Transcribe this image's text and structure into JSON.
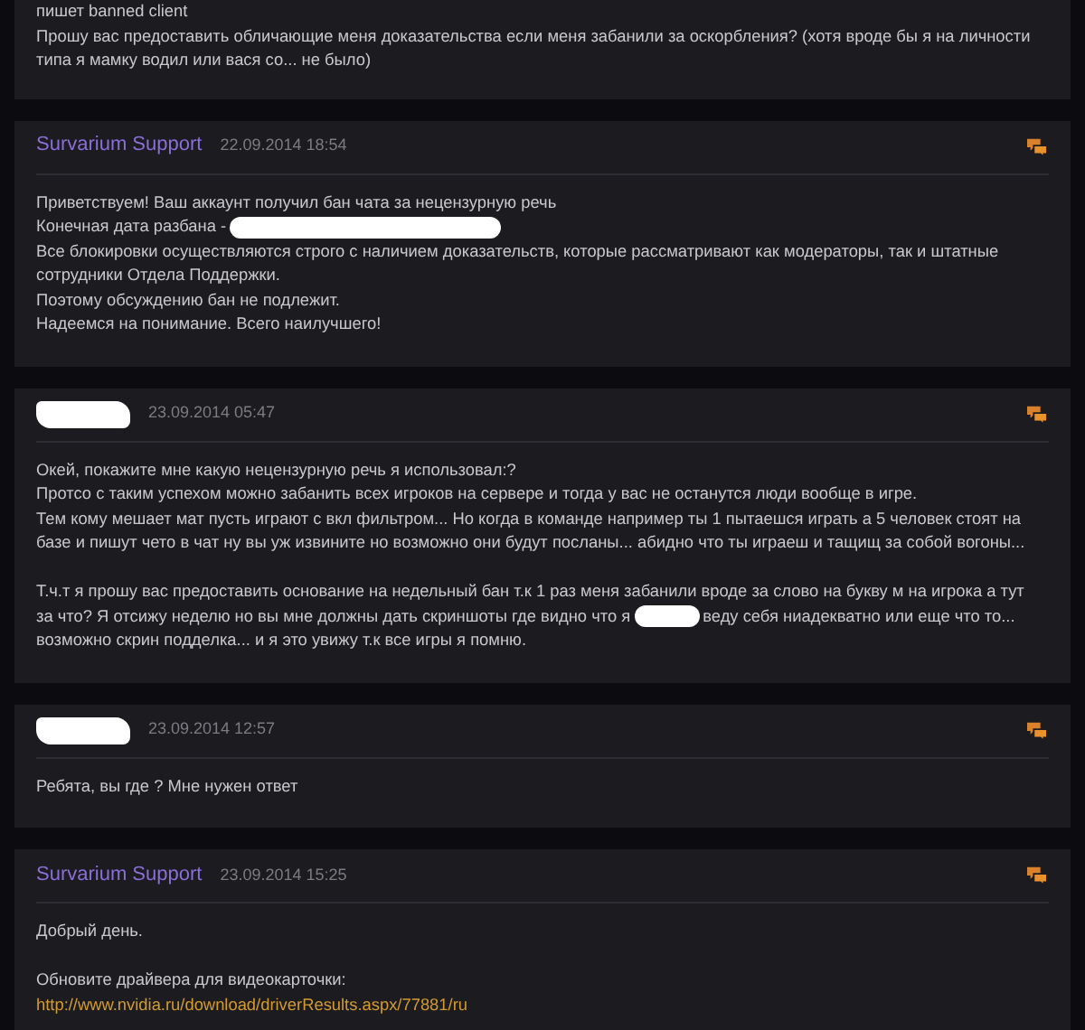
{
  "posts": [
    {
      "paragraphs": [
        [
          "пишет banned client",
          "Прошу вас предоставить обличающие меня доказательства если меня забанили за оскорбления? (хотя вроде бы я на личности",
          "типа я мамку водил или вася со... не было)"
        ]
      ]
    },
    {
      "header": {
        "author": {
          "kind": "support",
          "name": "Survarium Support"
        },
        "date": "22.09.2014 18:54"
      },
      "paragraphs": [
        [
          "Приветствуем! Ваш аккаунт получил бан чата за нецензурную речь",
          {
            "segments": [
              {
                "kind": "text",
                "text": "Конечная дата разбана -"
              },
              {
                "kind": "redacted"
              }
            ]
          },
          "Все блокировки осуществляются строго с наличием доказательств, которые рассматривают как модераторы, так и штатные",
          "сотрудники Отдела Поддержки.",
          "Поэтому обсуждению бан не подлежит.",
          "Надеемся на понимание. Всего наилучшего!"
        ]
      ]
    },
    {
      "header": {
        "author": {
          "kind": "redacted"
        },
        "date": "23.09.2014 05:47"
      },
      "paragraphs": [
        [
          "Окей, покажите мне какую нецензурную речь я использовал:?",
          "Протсо с таким успехом можно забанить всех игроков на сервере и тогда у вас не останутся люди вообще в игре.",
          "Тем кому мешает мат пусть играют с вкл фильтром... Но когда в команде например ты 1 пытаешся играть а 5 человек стоят на",
          "базе и пишут чето в чат ну вы уж извините но возможно они будут посланы... абидно что ты играеш и тащищ за собой вогоны..."
        ],
        [
          "Т.ч.т я прошу вас предоставить основание на недельный бан т.к 1 раз меня забанили вроде за слово на букву м на игрока а тут",
          {
            "segments": [
              {
                "kind": "text",
                "text": "за что? Я отсижу неделю но вы мне должны дать скриншоты где видно что я"
              },
              {
                "kind": "redacted"
              },
              {
                "kind": "text",
                "text": "веду себя ниадекватно или еще что то..."
              }
            ]
          },
          "возможно скрин подделка... и я это увижу т.к все игры я помню."
        ]
      ]
    },
    {
      "header": {
        "author": {
          "kind": "redacted"
        },
        "date": "23.09.2014 12:57"
      },
      "paragraphs": [
        [
          "Ребята, вы где ? Мне нужен ответ"
        ]
      ]
    },
    {
      "header": {
        "author": {
          "kind": "support",
          "name": "Survarium Support"
        },
        "date": "23.09.2014 15:25"
      },
      "paragraphs": [
        [
          "Добрый день."
        ],
        [
          "Обновите драйвера для видеокарточки:",
          {
            "link": "http://www.nvidia.ru/download/driverResults.aspx/77881/ru"
          }
        ]
      ]
    }
  ]
}
